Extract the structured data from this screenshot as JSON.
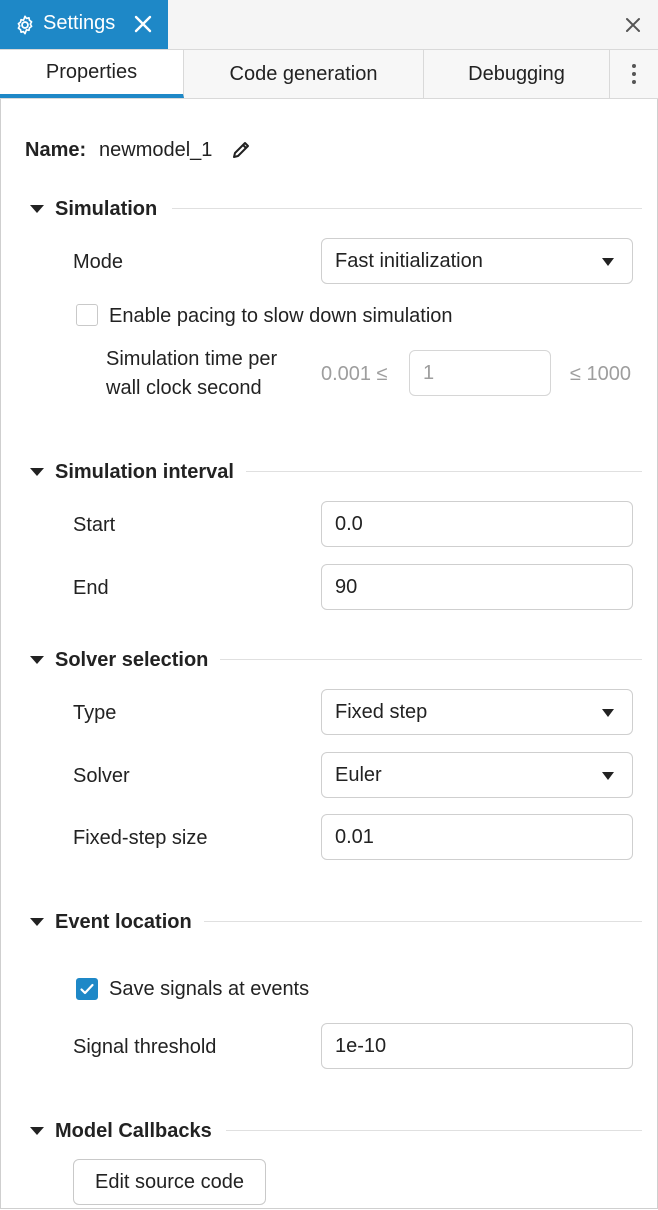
{
  "window": {
    "tab_title": "Settings",
    "tab_icon": "gear-icon",
    "close_icon": "close-icon"
  },
  "tabs": [
    {
      "label": "Properties",
      "active": true
    },
    {
      "label": "Code generation",
      "active": false
    },
    {
      "label": "Debugging",
      "active": false
    }
  ],
  "name_row": {
    "label": "Name:",
    "value": "newmodel_1",
    "icon": "pencil-icon"
  },
  "simulation": {
    "title": "Simulation",
    "mode_label": "Mode",
    "mode_value": "Fast initialization",
    "pacing_label": "Enable pacing to slow down simulation",
    "pacing_checked": false,
    "time_label_line1": "Simulation time per",
    "time_label_line2": "wall clock second",
    "time_min": "0.001 ≤",
    "time_value": "1",
    "time_max": "≤ 1000"
  },
  "interval": {
    "title": "Simulation interval",
    "start_label": "Start",
    "start_value": "0.0",
    "end_label": "End",
    "end_value": "90"
  },
  "solver": {
    "title": "Solver selection",
    "type_label": "Type",
    "type_value": "Fixed step",
    "solver_label": "Solver",
    "solver_value": "Euler",
    "step_label": "Fixed-step size",
    "step_value": "0.01"
  },
  "event": {
    "title": "Event location",
    "save_label": "Save signals at events",
    "save_checked": true,
    "threshold_label": "Signal threshold",
    "threshold_value": "1e-10"
  },
  "callbacks": {
    "title": "Model Callbacks",
    "button_label": "Edit source code"
  },
  "colors": {
    "accent": "#1e88c7",
    "border": "#cfcfcf",
    "muted": "#9e9e9e"
  }
}
